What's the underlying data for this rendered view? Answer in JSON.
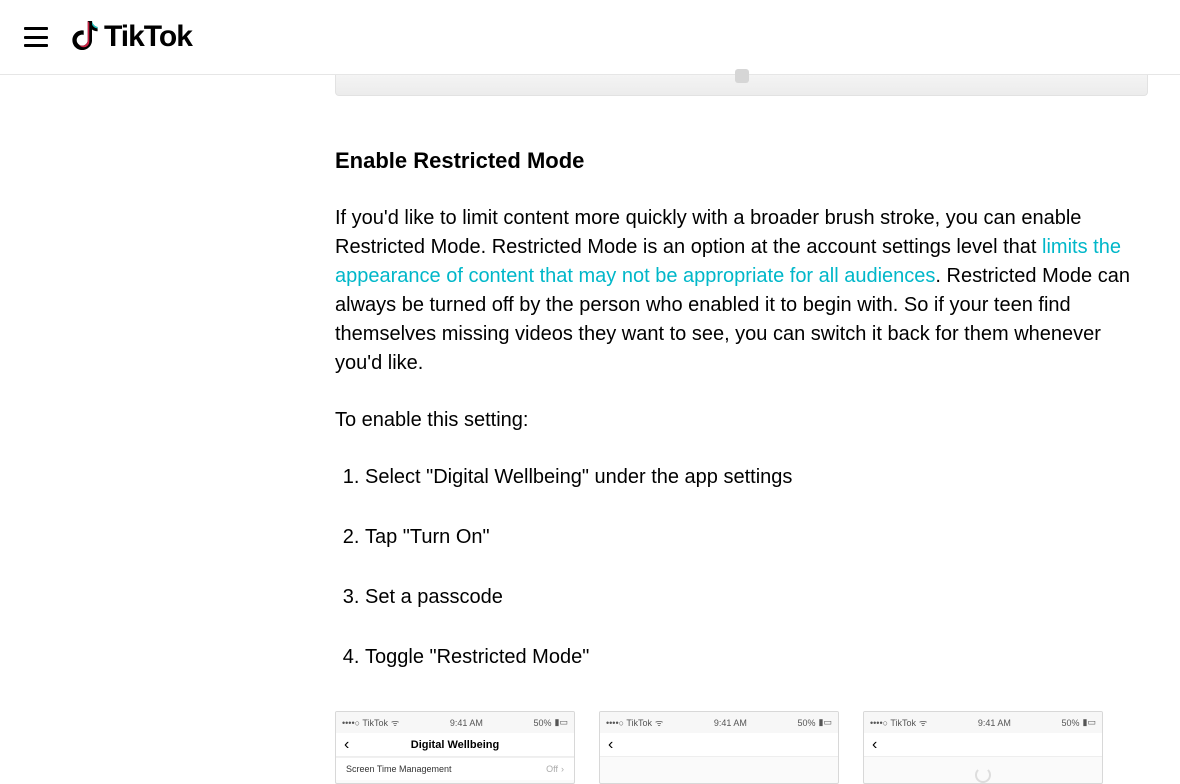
{
  "header": {
    "brand": "TikTok"
  },
  "article": {
    "section_title": "Enable Restricted Mode",
    "para1_pre": "If you'd like to limit content more quickly with a broader brush stroke, you can enable Restricted Mode. Restricted Mode is an option at the account settings level that ",
    "para1_link": "limits the appearance of content that may not be appropriate for all audiences",
    "para1_post": ". Restricted Mode can always be turned off by the person who enabled it to begin with. So if your teen find themselves missing videos they want to see, you can switch it back for them whenever you'd like.",
    "para2": "To enable this setting:",
    "steps": [
      "Select \"Digital Wellbeing\" under the app settings",
      "Tap \"Turn On\"",
      "Set a passcode",
      "Toggle \"Restricted Mode\""
    ]
  },
  "phones": {
    "status_carrier": "••••○ TikTok",
    "status_time": "9:41 AM",
    "status_batt": "50%",
    "shot1": {
      "title": "Digital Wellbeing",
      "row1_label": "Screen Time Management",
      "row1_val": "Off"
    }
  }
}
